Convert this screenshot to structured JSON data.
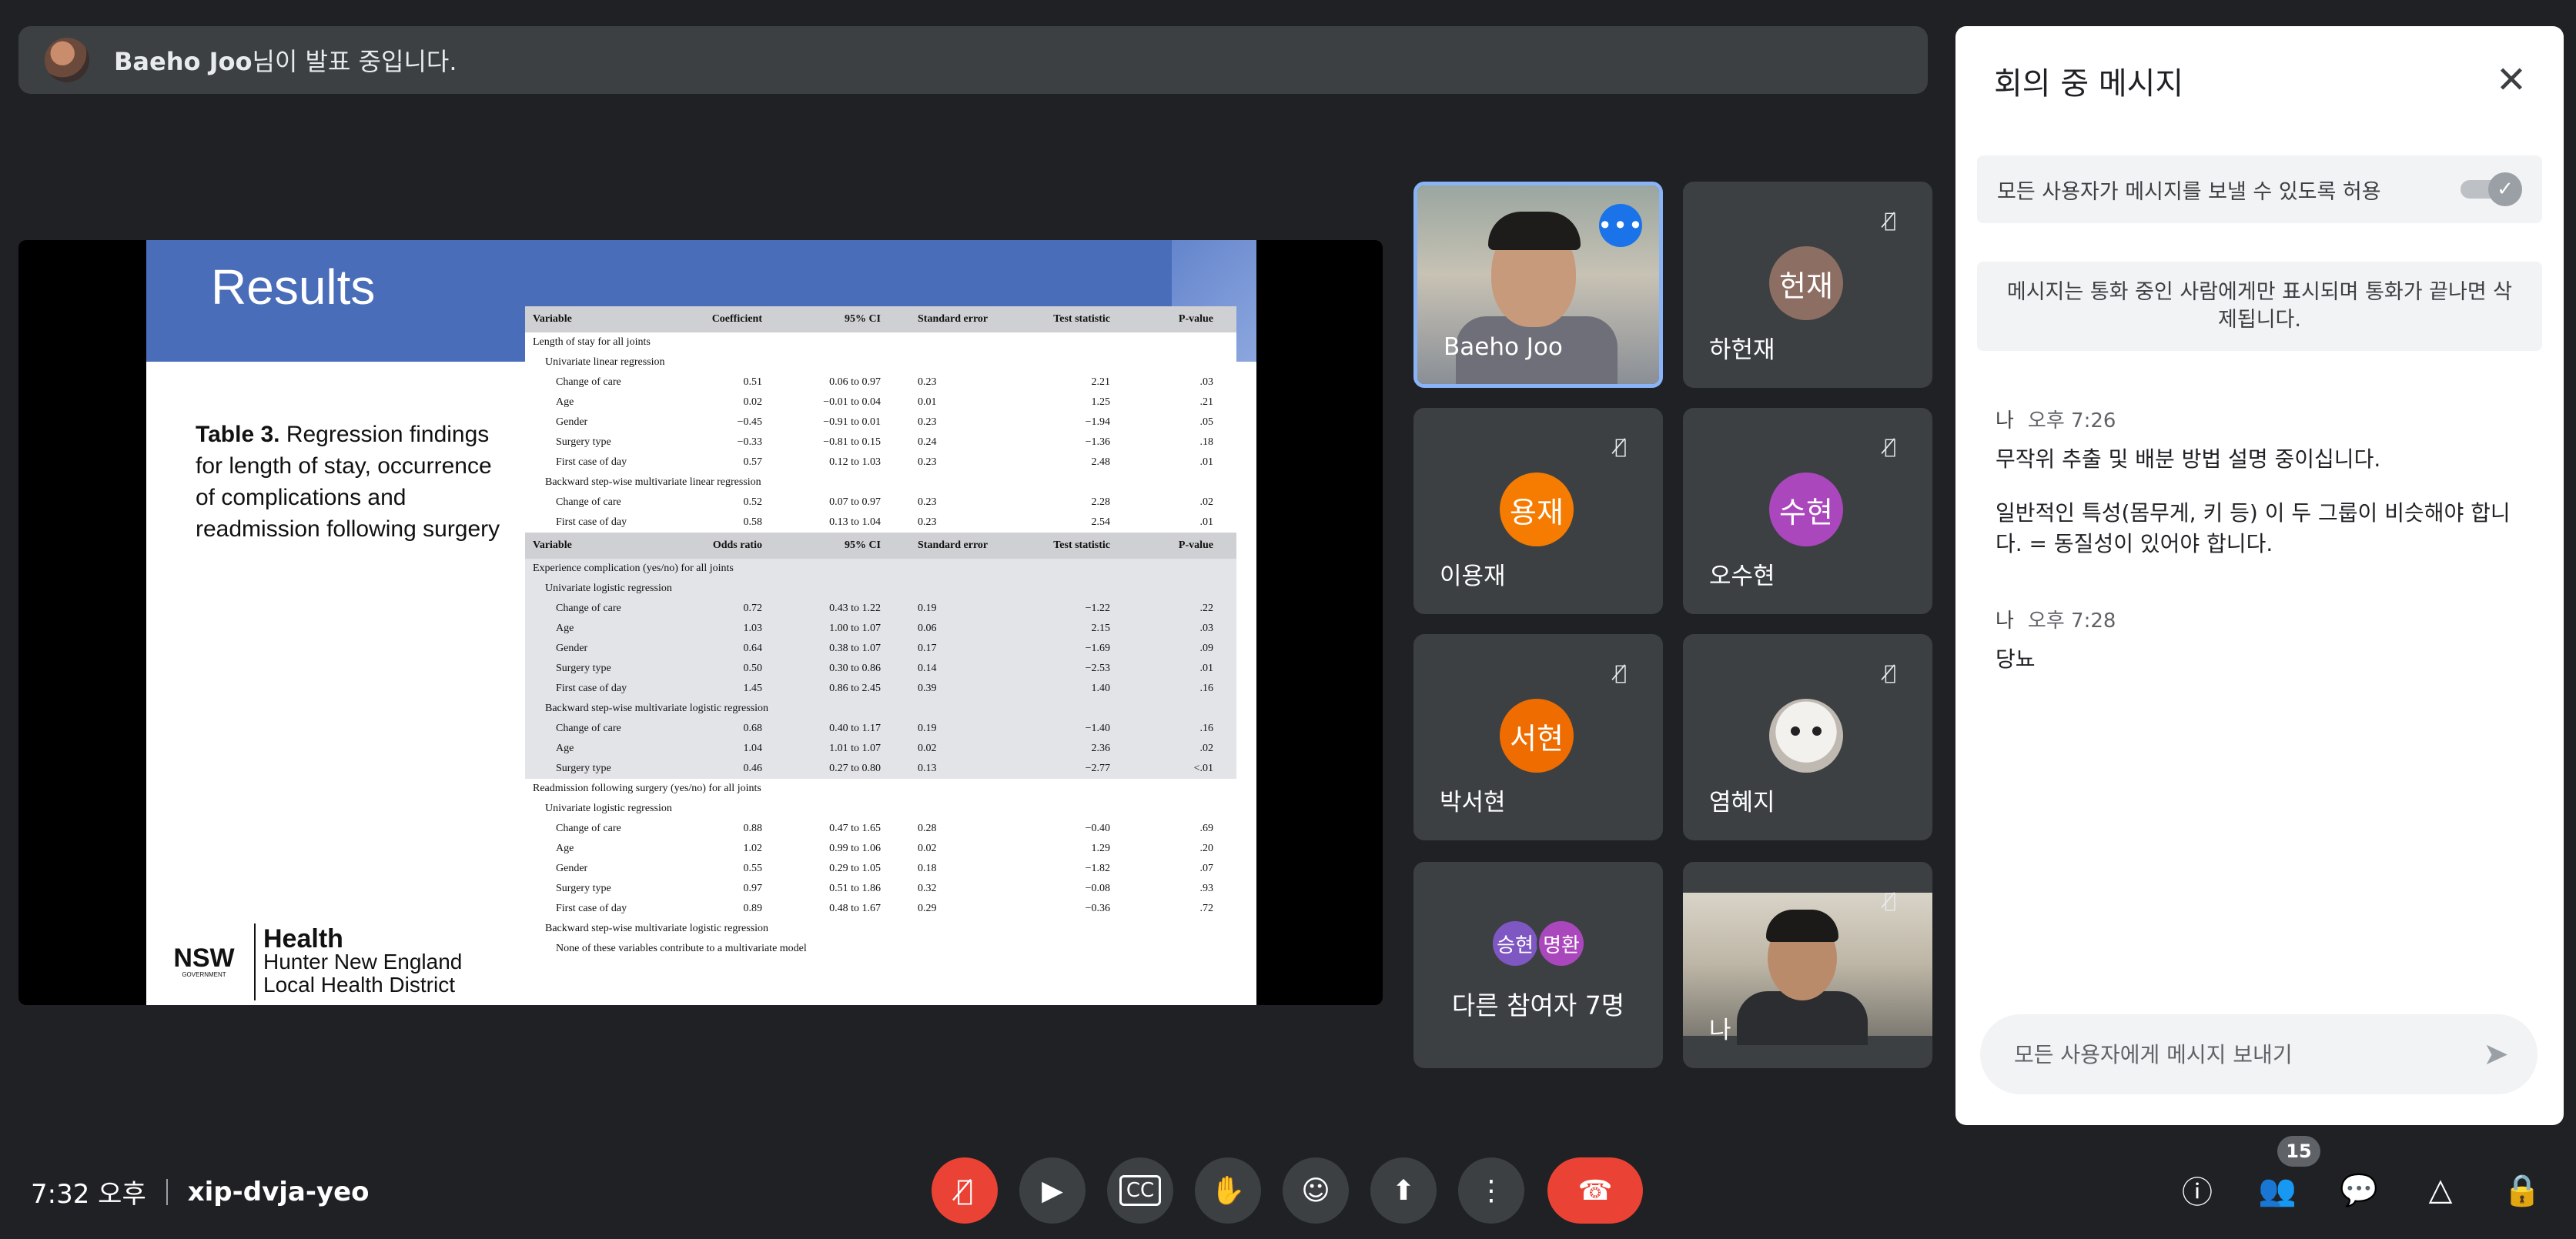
{
  "banner": {
    "presenter": "Baeho Joo",
    "suffix": "님이 발표 중입니다."
  },
  "slide": {
    "title": "Results",
    "caption_bold": "Table 3.",
    "caption_rest": " Regression findings for length of stay, occurrence of complications and readmission following surgery",
    "logo_nsw": "NSW",
    "logo_nsw_small": "GOVERNMENT",
    "logo_health": "Health",
    "logo_line2": "Hunter New England",
    "logo_line3": "Local Health District"
  },
  "table": {
    "hdr1": [
      "Variable",
      "Coefficient",
      "95% CI",
      "Standard error",
      "Test statistic",
      "P-value"
    ],
    "sec1": "Length of stay for all joints",
    "sub1": "Univariate linear regression",
    "rows1": [
      [
        "Change of care",
        "0.51",
        "0.06 to 0.97",
        "0.23",
        "2.21",
        ".03"
      ],
      [
        "Age",
        "0.02",
        "−0.01 to 0.04",
        "0.01",
        "1.25",
        ".21"
      ],
      [
        "Gender",
        "−0.45",
        "−0.91 to 0.01",
        "0.23",
        "−1.94",
        ".05"
      ],
      [
        "Surgery type",
        "−0.33",
        "−0.81 to 0.15",
        "0.24",
        "−1.36",
        ".18"
      ],
      [
        "First case of day",
        "0.57",
        "0.12 to 1.03",
        "0.23",
        "2.48",
        ".01"
      ]
    ],
    "sub2": "Backward step-wise multivariate linear regression",
    "rows2": [
      [
        "Change of care",
        "0.52",
        "0.07 to 0.97",
        "0.23",
        "2.28",
        ".02"
      ],
      [
        "First case of day",
        "0.58",
        "0.13 to 1.04",
        "0.23",
        "2.54",
        ".01"
      ]
    ],
    "hdr2": [
      "Variable",
      "Odds ratio",
      "95% CI",
      "Standard error",
      "Test statistic",
      "P-value"
    ],
    "sec2": "Experience complication (yes/no) for all joints",
    "sub3": "Univariate logistic regression",
    "rows3": [
      [
        "Change of care",
        "0.72",
        "0.43 to 1.22",
        "0.19",
        "−1.22",
        ".22"
      ],
      [
        "Age",
        "1.03",
        "1.00 to 1.07",
        "0.06",
        "2.15",
        ".03"
      ],
      [
        "Gender",
        "0.64",
        "0.38 to 1.07",
        "0.17",
        "−1.69",
        ".09"
      ],
      [
        "Surgery type",
        "0.50",
        "0.30 to 0.86",
        "0.14",
        "−2.53",
        ".01"
      ],
      [
        "First case of day",
        "1.45",
        "0.86 to 2.45",
        "0.39",
        "1.40",
        ".16"
      ]
    ],
    "sub4": "Backward step-wise multivariate logistic regression",
    "rows4": [
      [
        "Change of care",
        "0.68",
        "0.40 to 1.17",
        "0.19",
        "−1.40",
        ".16"
      ],
      [
        "Age",
        "1.04",
        "1.01 to 1.07",
        "0.02",
        "2.36",
        ".02"
      ],
      [
        "Surgery type",
        "0.46",
        "0.27 to 0.80",
        "0.13",
        "−2.77",
        "<.01"
      ]
    ],
    "sec3": "Readmission following surgery (yes/no) for all joints",
    "sub5": "Univariate logistic regression",
    "rows5": [
      [
        "Change of care",
        "0.88",
        "0.47 to 1.65",
        "0.28",
        "−0.40",
        ".69"
      ],
      [
        "Age",
        "1.02",
        "0.99 to 1.06",
        "0.02",
        "1.29",
        ".20"
      ],
      [
        "Gender",
        "0.55",
        "0.29 to 1.05",
        "0.18",
        "−1.82",
        ".07"
      ],
      [
        "Surgery type",
        "0.97",
        "0.51 to 1.86",
        "0.32",
        "−0.08",
        ".93"
      ],
      [
        "First case of day",
        "0.89",
        "0.48 to 1.67",
        "0.29",
        "−0.36",
        ".72"
      ]
    ],
    "sub6": "Backward step-wise multivariate logistic regression",
    "note": "None of these variables contribute to a multivariate model"
  },
  "participants": {
    "p1": {
      "name": "Baeho Joo"
    },
    "p2": {
      "name": "하헌재",
      "initials": "헌재",
      "color": "#8d6e63"
    },
    "p3": {
      "name": "이용재",
      "initials": "용재",
      "color": "#f57c00"
    },
    "p4": {
      "name": "오수현",
      "initials": "수현",
      "color": "#ab47bc"
    },
    "p5": {
      "name": "박서현",
      "initials": "서현",
      "color": "#ef6c00"
    },
    "p6": {
      "name": "염혜지"
    },
    "others": {
      "a": "승현",
      "a_color": "#7e57c2",
      "b": "명환",
      "b_color": "#ab47bc",
      "label": "다른 참여자 7명"
    },
    "self": {
      "name": "나"
    }
  },
  "chat": {
    "title": "회의 중 메시지",
    "allow_label": "모든 사용자가 메시지를 보낼 수 있도록 허용",
    "notice": "메시지는 통화 중인 사람에게만 표시되며 통화가 끝나면 삭제됩니다.",
    "m1": {
      "sender": "나",
      "time": "오후 7:26",
      "lines": [
        "무작위 추출 및 배분 방법 설명 중이십니다.",
        "일반적인 특성(몸무게, 키 등) 이 두 그룹이 비슷해야 합니다. = 동질성이 있어야 합니다."
      ]
    },
    "m2": {
      "sender": "나",
      "time": "오후 7:28",
      "lines": [
        "당뇨"
      ]
    },
    "placeholder": "모든 사용자에게 메시지 보내기"
  },
  "bottom": {
    "time": "7:32 오후",
    "code": "xip-dvja-yeo",
    "people_badge": "15"
  }
}
